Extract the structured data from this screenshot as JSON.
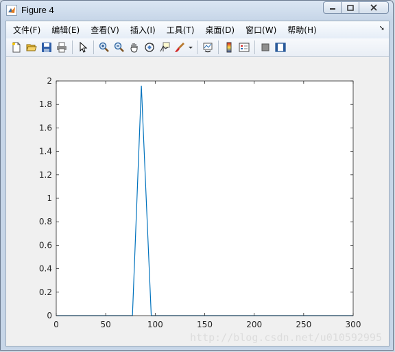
{
  "window": {
    "title": "Figure 4"
  },
  "menubar": {
    "items": [
      "文件(F)",
      "编辑(E)",
      "查看(V)",
      "插入(I)",
      "工具(T)",
      "桌面(D)",
      "窗口(W)",
      "帮助(H)"
    ]
  },
  "toolbar": {
    "icons": [
      "new-figure-icon",
      "open-file-icon",
      "save-icon",
      "print-icon",
      "select-arrow-icon",
      "zoom-in-icon",
      "zoom-out-icon",
      "pan-hand-icon",
      "rotate-3d-icon",
      "data-cursor-icon",
      "brush-icon",
      "brush-dropdown-icon",
      "link-plot-icon",
      "colorbar-icon",
      "legend-icon",
      "hide-plot-tools-icon",
      "show-plot-tools-icon"
    ]
  },
  "watermark": "http://blog.csdn.net/u010592995",
  "chart_data": {
    "type": "line",
    "title": "",
    "xlabel": "",
    "ylabel": "",
    "xlim": [
      0,
      300
    ],
    "ylim": [
      0,
      2
    ],
    "xticks": [
      0,
      50,
      100,
      150,
      200,
      250,
      300
    ],
    "yticks": [
      0,
      0.2,
      0.4,
      0.6,
      0.8,
      1,
      1.2,
      1.4,
      1.6,
      1.8,
      2
    ],
    "grid": false,
    "series": [
      {
        "color": "#0072bd",
        "x": [
          0,
          77,
          86,
          96,
          300
        ],
        "y": [
          0,
          0,
          1.96,
          0,
          0
        ]
      }
    ]
  }
}
